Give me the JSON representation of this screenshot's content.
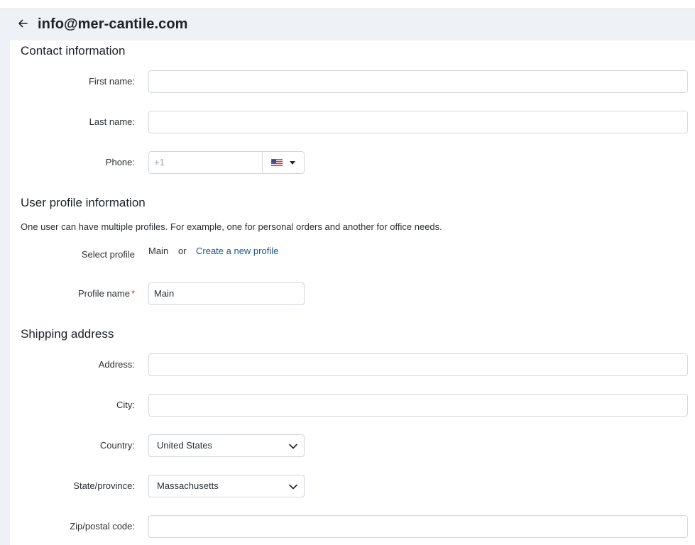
{
  "header": {
    "title": "info@mer-cantile.com"
  },
  "contact": {
    "section_title": "Contact information",
    "first_name_label": "First name:",
    "first_name_value": "",
    "last_name_label": "Last name:",
    "last_name_value": "",
    "phone_label": "Phone:",
    "phone_placeholder": "+1",
    "phone_country_icon": "us-flag-icon"
  },
  "profile": {
    "section_title": "User profile information",
    "description": "One user can have multiple profiles. For example, one for personal orders and another for office needs.",
    "select_label": "Select profile",
    "current_profile": "Main",
    "or_text": "or",
    "create_link": "Create a new profile",
    "name_label": "Profile name",
    "required_mark": "*",
    "name_value": "Main"
  },
  "shipping": {
    "section_title": "Shipping address",
    "address_label": "Address:",
    "address_value": "",
    "city_label": "City:",
    "city_value": "",
    "country_label": "Country:",
    "country_value": "United States",
    "state_label": "State/province:",
    "state_value": "Massachusetts",
    "zip_label": "Zip/postal code:",
    "zip_value": ""
  },
  "colors": {
    "link": "#1e5a8a",
    "required": "#d9342b",
    "header_bg": "#eef2f7"
  }
}
